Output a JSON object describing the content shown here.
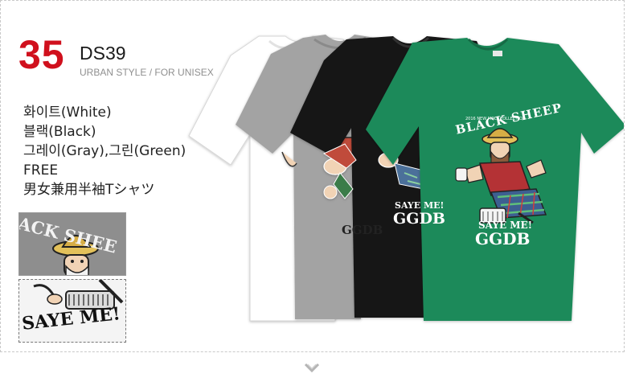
{
  "product": {
    "number": "35",
    "code": "DS39",
    "subtitle": "URBAN STYLE / FOR UNISEX",
    "number_color": "#d0101d"
  },
  "features": [
    "화이트(White)",
    "블랙(Black)",
    "그레이(Gray),그린(Green)",
    "FREE",
    "男女兼用半袖Tシャツ"
  ],
  "thumbnails": [
    {
      "label": "ACK SHEE",
      "color": "gray"
    },
    {
      "label": "SAYE ME!",
      "color": "white"
    }
  ],
  "shirts": {
    "colors": {
      "white": "#ffffff",
      "gray": "#9a9a9a",
      "black": "#111111",
      "green": "#1d8a5a"
    },
    "black_print": {
      "slogan": "SAYE ME!",
      "initials": "GGDB"
    },
    "green_print": {
      "collection": "2016 NEW MOLT COLLECTION",
      "title": "BLACK SHEEP",
      "slogan": "SAYE ME!",
      "initials": "GGDB"
    },
    "gray_print": {
      "initials": "GGDB"
    }
  },
  "nav": {
    "icon": "chevron-down-icon"
  }
}
